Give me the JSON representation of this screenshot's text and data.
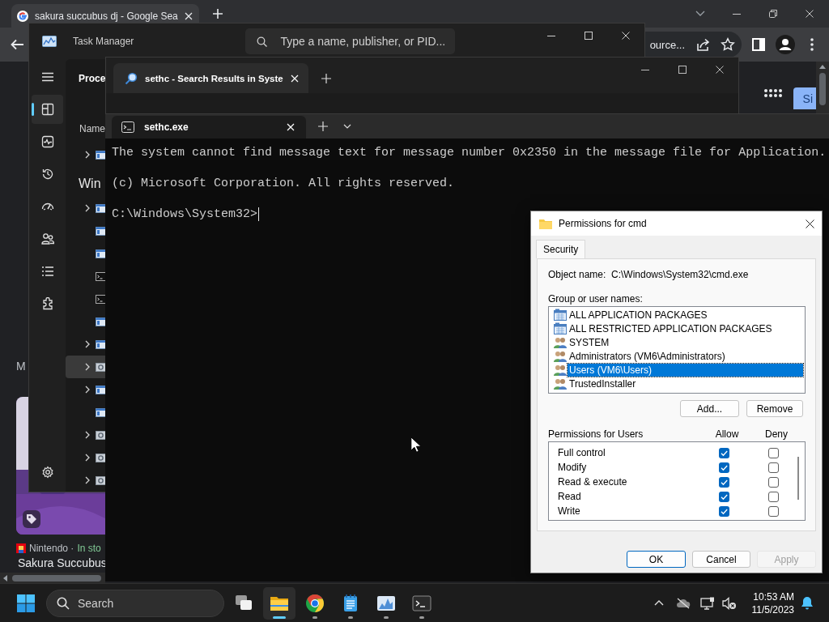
{
  "browser": {
    "tab_title": "sakura succubus dj - Google Sea",
    "address_text": "ource...",
    "sign_in_label": "Si",
    "result": {
      "snippet_text": "M",
      "seller": "Nintendo ·",
      "availability": "In sto",
      "title": "Sakura Succubus"
    }
  },
  "task_manager": {
    "title": "Task Manager",
    "search_placeholder": "Type a name, publisher, or PID...",
    "nav": [
      {
        "selected": false
      },
      {
        "selected": true
      },
      {
        "selected": false
      },
      {
        "selected": false
      },
      {
        "selected": false
      },
      {
        "selected": false
      },
      {
        "selected": false
      },
      {
        "selected": false
      },
      {
        "selected": false
      }
    ],
    "page_title": "Proce",
    "column_1": "Name",
    "rows": [
      {
        "expandable": true,
        "kind": "app",
        "highlighted": false
      }
    ],
    "groups": [
      {
        "label": "Win",
        "rows": [
          {
            "expandable": true,
            "kind": "app",
            "highlighted": false
          },
          {
            "expandable": false,
            "kind": "app",
            "highlighted": false
          },
          {
            "expandable": false,
            "kind": "app",
            "highlighted": false
          },
          {
            "expandable": false,
            "kind": "console",
            "highlighted": false
          },
          {
            "expandable": false,
            "kind": "console",
            "highlighted": false
          },
          {
            "expandable": false,
            "kind": "app",
            "highlighted": false
          },
          {
            "expandable": true,
            "kind": "app",
            "highlighted": false
          },
          {
            "expandable": true,
            "kind": "service",
            "highlighted": true
          },
          {
            "expandable": true,
            "kind": "app",
            "highlighted": false
          },
          {
            "expandable": false,
            "kind": "app",
            "highlighted": false
          },
          {
            "expandable": true,
            "kind": "service",
            "highlighted": false
          },
          {
            "expandable": true,
            "kind": "service",
            "highlighted": false
          },
          {
            "expandable": true,
            "kind": "service",
            "highlighted": false
          }
        ]
      }
    ]
  },
  "explorer": {
    "tab_title": "sethc - Search Results in Syste"
  },
  "terminal": {
    "tab_title": "sethc.exe",
    "lines": [
      "The system cannot find message text for message number 0x2350 in the message file for Application.",
      "(c) Microsoft Corporation. All rights reserved.",
      "C:\\Windows\\System32>"
    ]
  },
  "dialog": {
    "title": "Permissions for cmd",
    "tabs": [
      {
        "label": "Security",
        "selected": true
      }
    ],
    "object_label": "Object name:",
    "object_value": "C:\\Windows\\System32\\cmd.exe",
    "groups_label": "Group or user names:",
    "groups": [
      {
        "name": "ALL APPLICATION PACKAGES",
        "kind": "package",
        "selected": false
      },
      {
        "name": "ALL RESTRICTED APPLICATION PACKAGES",
        "kind": "package",
        "selected": false
      },
      {
        "name": "SYSTEM",
        "kind": "group",
        "selected": false
      },
      {
        "name": "Administrators (VM6\\Administrators)",
        "kind": "group",
        "selected": false
      },
      {
        "name": "Users (VM6\\Users)",
        "kind": "group",
        "selected": true
      },
      {
        "name": "TrustedInstaller",
        "kind": "group",
        "selected": false
      }
    ],
    "add_label": "Add...",
    "remove_label": "Remove",
    "permissions_label": "Permissions for Users",
    "allow_label": "Allow",
    "deny_label": "Deny",
    "permissions": [
      {
        "name": "Full control",
        "allow": true,
        "deny": false
      },
      {
        "name": "Modify",
        "allow": true,
        "deny": false
      },
      {
        "name": "Read & execute",
        "allow": true,
        "deny": false
      },
      {
        "name": "Read",
        "allow": true,
        "deny": false
      },
      {
        "name": "Write",
        "allow": true,
        "deny": false
      }
    ],
    "buttons": [
      {
        "label": "OK",
        "default": true,
        "disabled": false
      },
      {
        "label": "Cancel",
        "default": false,
        "disabled": false
      },
      {
        "label": "Apply",
        "default": false,
        "disabled": true
      }
    ]
  },
  "taskbar": {
    "search_placeholder": "Search",
    "apps": [
      {
        "active": false,
        "running": false
      },
      {
        "active": true,
        "running": true
      },
      {
        "active": false,
        "running": true
      },
      {
        "active": false,
        "running": true
      },
      {
        "active": false,
        "running": true
      },
      {
        "active": false,
        "running": true
      }
    ],
    "time": "10:53 AM",
    "date": "11/5/2023"
  }
}
